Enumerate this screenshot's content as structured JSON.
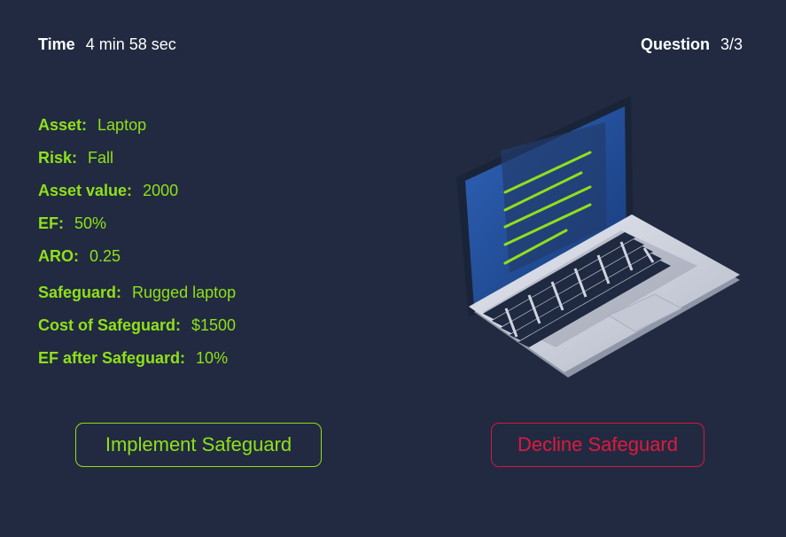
{
  "header": {
    "time_label": "Time",
    "time_value": "4 min 58 sec",
    "question_label": "Question",
    "question_value": "3/3"
  },
  "scenario": [
    {
      "key": "Asset:",
      "value": "Laptop"
    },
    {
      "key": "Risk:",
      "value": "Fall"
    },
    {
      "key": "Asset value:",
      "value": "2000"
    },
    {
      "key": "EF:",
      "value": "50%"
    },
    {
      "key": "ARO:",
      "value": "0.25"
    },
    {
      "key": "Safeguard:",
      "value": "Rugged laptop"
    },
    {
      "key": "Cost of Safeguard:",
      "value": "$1500"
    },
    {
      "key": "EF after Safeguard:",
      "value": "10%"
    }
  ],
  "actions": {
    "implement_label": "Implement Safeguard",
    "decline_label": "Decline Safeguard"
  },
  "illustration": {
    "icon": "laptop-illustration"
  },
  "colors": {
    "background": "#212a40",
    "accent_green": "#8fe01a",
    "accent_red": "#e0193f"
  }
}
